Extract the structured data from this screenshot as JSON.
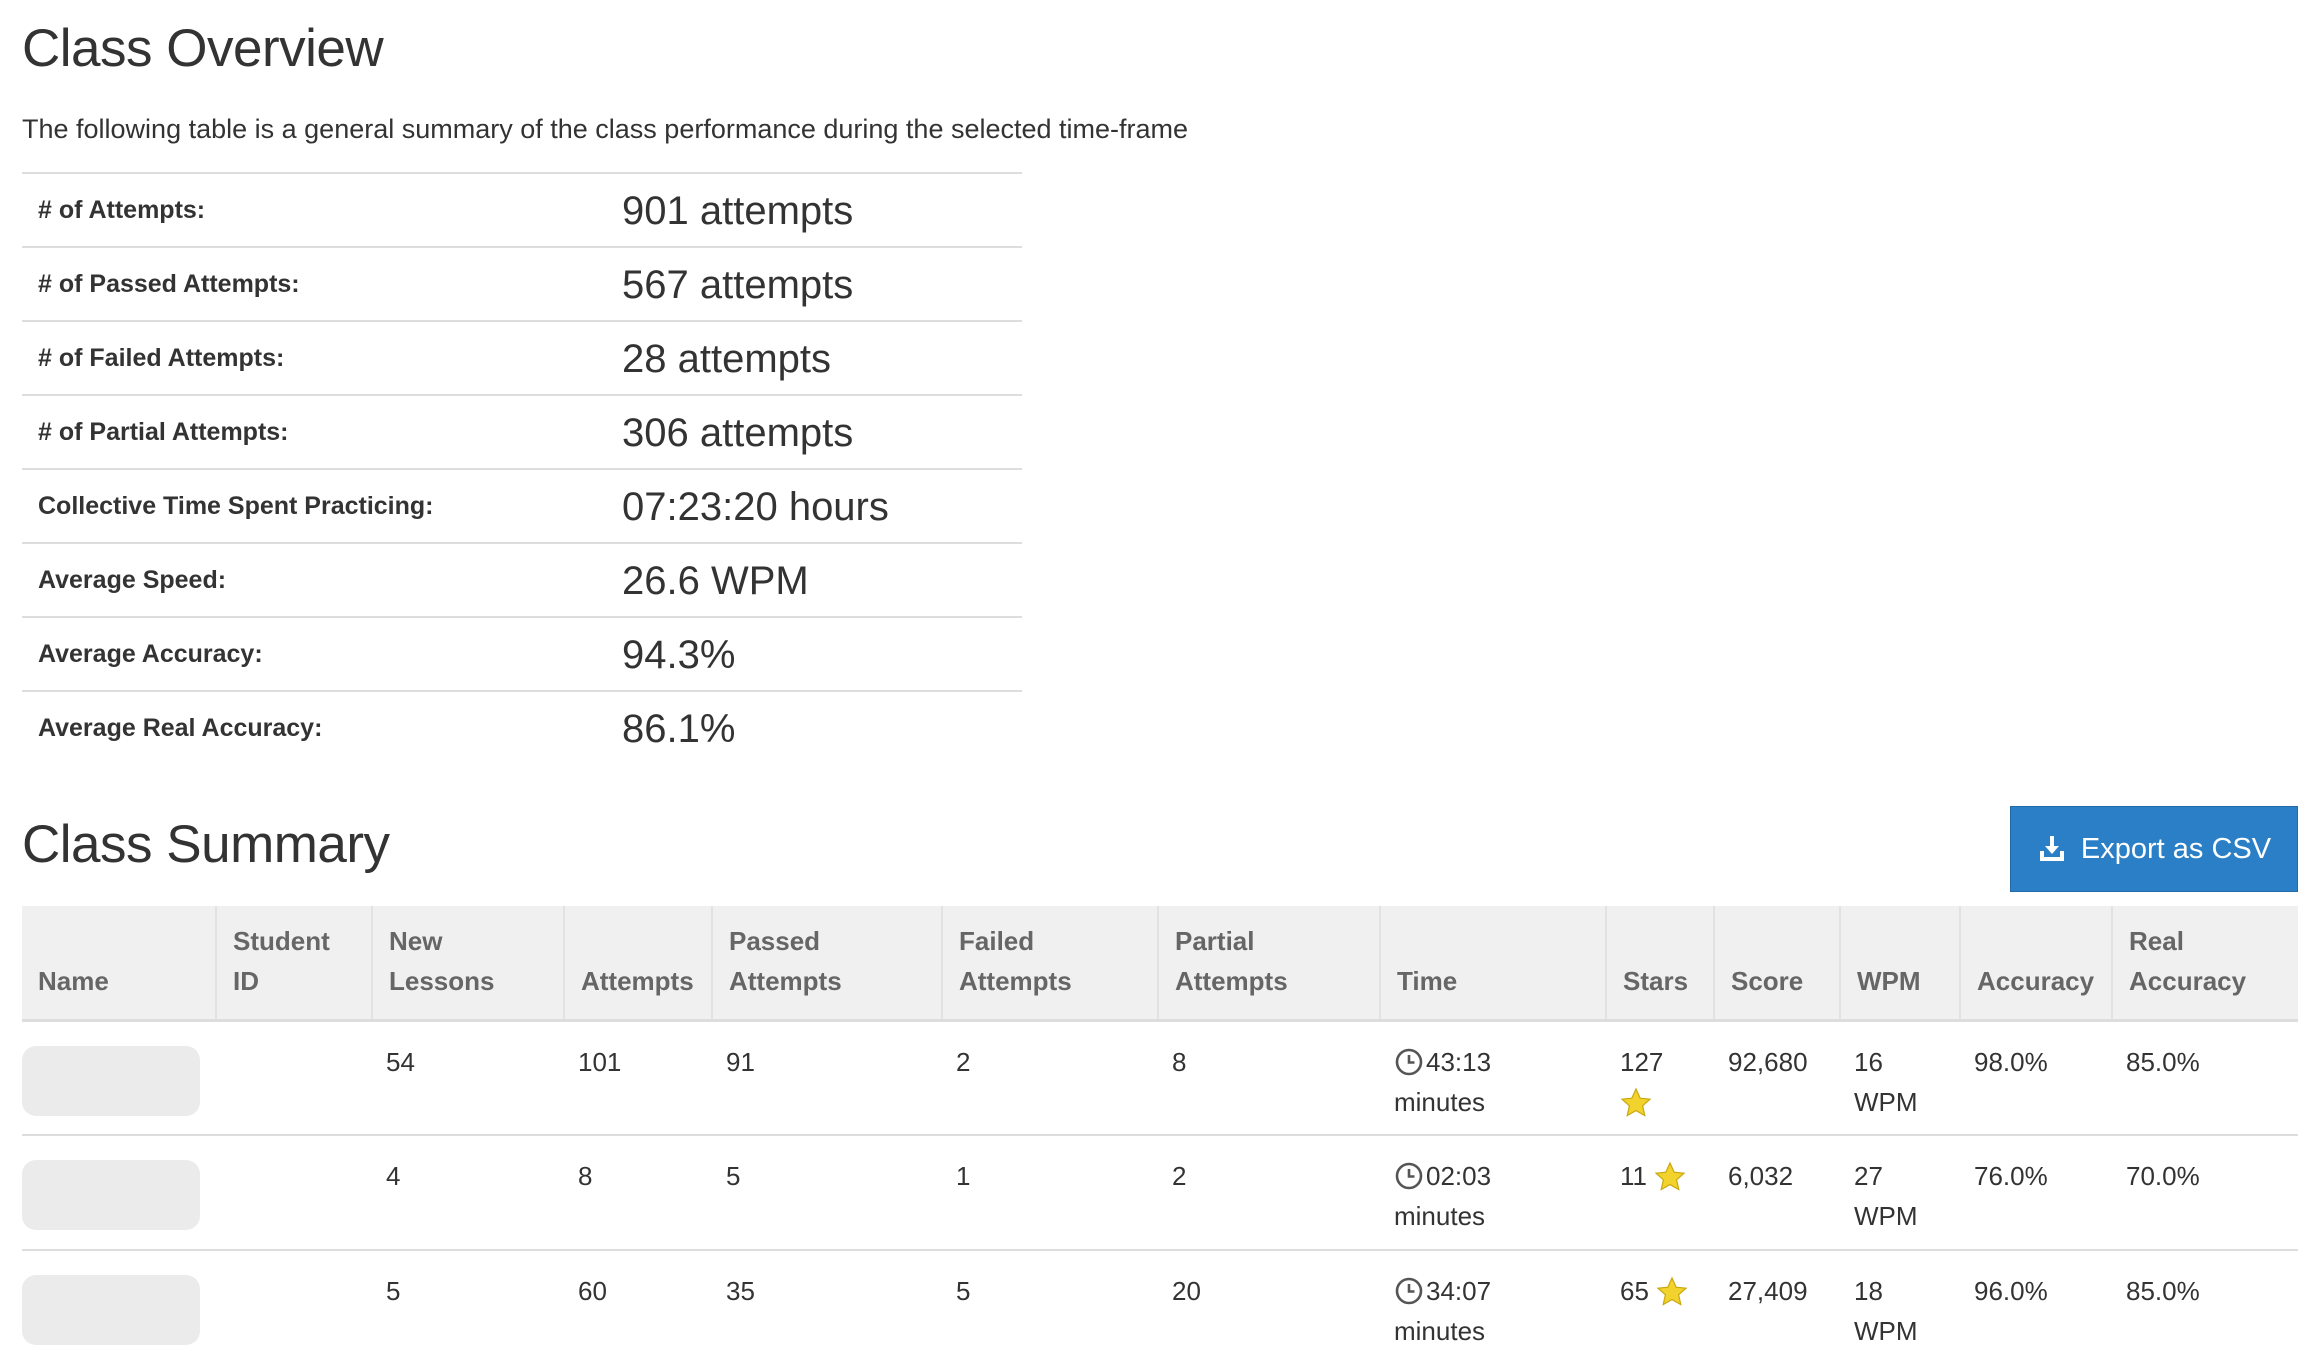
{
  "overview": {
    "title": "Class Overview",
    "description": "The following table is a general summary of the class performance during the selected time-frame",
    "rows": [
      {
        "label": "# of Attempts:",
        "value": "901 attempts"
      },
      {
        "label": "# of Passed Attempts:",
        "value": "567 attempts"
      },
      {
        "label": "# of Failed Attempts:",
        "value": "28 attempts"
      },
      {
        "label": "# of Partial Attempts:",
        "value": "306 attempts"
      },
      {
        "label": "Collective Time Spent Practicing:",
        "value": "07:23:20 hours"
      },
      {
        "label": "Average Speed:",
        "value": "26.6 WPM"
      },
      {
        "label": "Average Accuracy:",
        "value": "94.3%"
      },
      {
        "label": "Average Real Accuracy:",
        "value": "86.1%"
      }
    ]
  },
  "summary": {
    "title": "Class Summary",
    "export_label": "Export as CSV",
    "export_icon": "download-icon",
    "columns": {
      "name": "Name",
      "student_id_1": "Student",
      "student_id_2": "ID",
      "new_lessons_1": "New",
      "new_lessons_2": "Lessons",
      "attempts": "Attempts",
      "passed_1": "Passed",
      "passed_2": "Attempts",
      "failed_1": "Failed",
      "failed_2": "Attempts",
      "partial_1": "Partial",
      "partial_2": "Attempts",
      "time": "Time",
      "stars": "Stars",
      "score": "Score",
      "wpm": "WPM",
      "accuracy": "Accuracy",
      "real_accuracy_1": "Real",
      "real_accuracy_2": "Accuracy"
    },
    "rows": [
      {
        "student_id": "",
        "new_lessons": "54",
        "attempts": "101",
        "passed": "91",
        "failed": "2",
        "partial": "8",
        "time": "43:13",
        "time_unit": "minutes",
        "stars": "127",
        "score": "92,680",
        "wpm": "16",
        "wpm_unit": "WPM",
        "accuracy": "98.0%",
        "real_accuracy": "85.0%"
      },
      {
        "student_id": "",
        "new_lessons": "4",
        "attempts": "8",
        "passed": "5",
        "failed": "1",
        "partial": "2",
        "time": "02:03",
        "time_unit": "minutes",
        "stars": "11",
        "score": "6,032",
        "wpm": "27",
        "wpm_unit": "WPM",
        "accuracy": "76.0%",
        "real_accuracy": "70.0%"
      },
      {
        "student_id": "",
        "new_lessons": "5",
        "attempts": "60",
        "passed": "35",
        "failed": "5",
        "partial": "20",
        "time": "34:07",
        "time_unit": "minutes",
        "stars": "65",
        "score": "27,409",
        "wpm": "18",
        "wpm_unit": "WPM",
        "accuracy": "96.0%",
        "real_accuracy": "85.0%"
      }
    ]
  },
  "icons": {
    "clock": "clock-icon",
    "star": "star-icon"
  },
  "colors": {
    "accent": "#2a7fc6",
    "star": "#f2d22c",
    "header_bg": "#f0f0f0"
  }
}
